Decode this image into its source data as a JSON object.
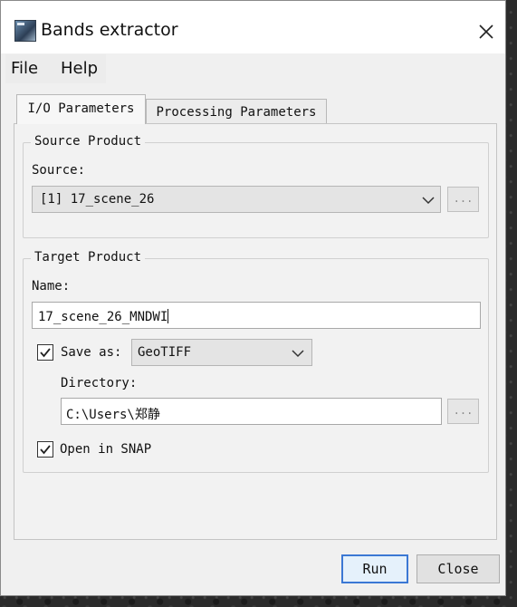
{
  "window": {
    "title": "Bands extractor"
  },
  "menu": {
    "file": "File",
    "help": "Help"
  },
  "tabs": [
    {
      "label": "I/O Parameters",
      "active": true
    },
    {
      "label": "Processing Parameters",
      "active": false
    }
  ],
  "source_product": {
    "group_title": "Source Product",
    "source_label": "Source:",
    "selected": "[1] 17_scene_26",
    "browse_label": "..."
  },
  "target_product": {
    "group_title": "Target Product",
    "name_label": "Name:",
    "name_value": "17_scene_26_MNDWI",
    "save_as_label": "Save as:",
    "save_as_checked": true,
    "format": "GeoTIFF",
    "directory_label": "Directory:",
    "directory_value": "C:\\Users\\郑静",
    "browse_label": "...",
    "open_in_snap_label": "Open in SNAP",
    "open_in_snap_checked": true
  },
  "buttons": {
    "run": "Run",
    "close": "Close"
  },
  "colors": {
    "accent": "#3b78d4",
    "window_bg": "#f0f0f0"
  }
}
